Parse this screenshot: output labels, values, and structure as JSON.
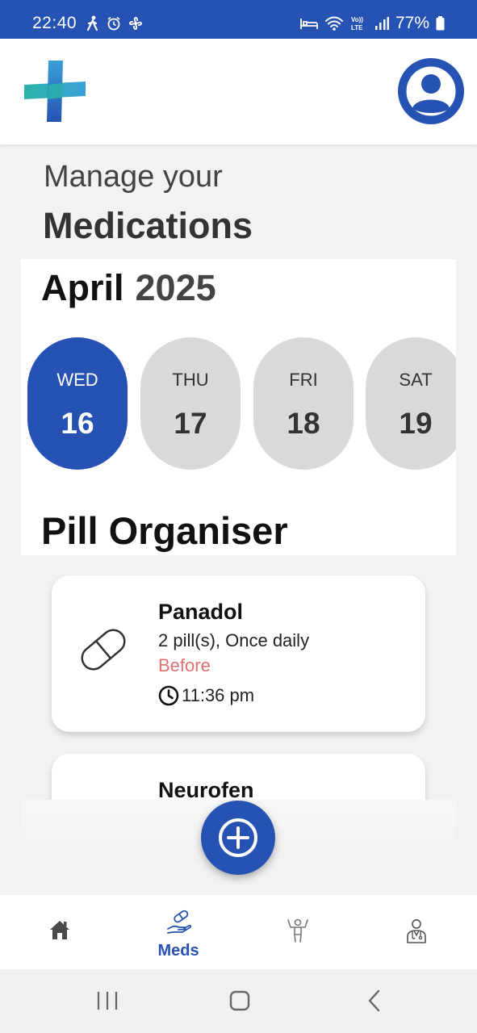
{
  "status_bar": {
    "time": "22:40",
    "battery": "77%",
    "left_icons": [
      "walk-icon",
      "alarm-icon",
      "fan-icon"
    ],
    "right_icons": [
      "bed-icon",
      "wifi-icon",
      "volte-icon",
      "signal-icon",
      "battery-icon"
    ],
    "background": "#2653b3"
  },
  "header": {
    "logo_icon": "medical-cross-logo",
    "profile_icon": "user-avatar-icon"
  },
  "page": {
    "subtitle": "Manage your",
    "title": "Medications"
  },
  "calendar": {
    "month": "April",
    "year": "2025",
    "days": [
      {
        "name": "WED",
        "number": "16",
        "selected": true
      },
      {
        "name": "THU",
        "number": "17",
        "selected": false
      },
      {
        "name": "FRI",
        "number": "18",
        "selected": false
      },
      {
        "name": "SAT",
        "number": "19",
        "selected": false
      }
    ]
  },
  "organiser": {
    "title": "Pill Organiser",
    "medications": [
      {
        "name": "Panadol",
        "dose": "2 pill(s), Once daily",
        "timing": "Before",
        "time": "11:36 pm",
        "icon": "capsule-icon"
      },
      {
        "name": "Neurofen"
      }
    ]
  },
  "add_button": {
    "icon": "add-circle-icon"
  },
  "bottom_nav": {
    "items": [
      {
        "icon": "home-icon",
        "label": ""
      },
      {
        "icon": "meds-hand-icon",
        "label": "Meds",
        "active": true
      },
      {
        "icon": "exercise-person-icon",
        "label": ""
      },
      {
        "icon": "doctor-icon",
        "label": ""
      }
    ]
  },
  "colors": {
    "accent": "#2653b3",
    "before_text": "#e07070",
    "inactive_day": "#d9d9d9"
  }
}
